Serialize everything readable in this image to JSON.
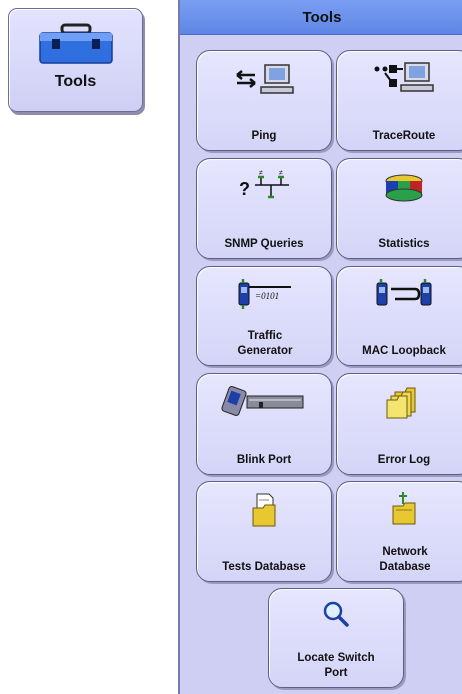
{
  "launcher": {
    "label": "Tools",
    "icon": "toolbox-icon"
  },
  "panel": {
    "title": "Tools",
    "items": [
      {
        "label": "Ping",
        "icon": "ping-icon"
      },
      {
        "label": "TraceRoute",
        "icon": "traceroute-icon"
      },
      {
        "label": "SNMP Queries",
        "icon": "snmp-queries-icon"
      },
      {
        "label": "Statistics",
        "icon": "statistics-icon"
      },
      {
        "label": "Traffic Generator",
        "icon": "traffic-generator-icon"
      },
      {
        "label": "MAC Loopback",
        "icon": "mac-loopback-icon"
      },
      {
        "label": "Blink Port",
        "icon": "blink-port-icon"
      },
      {
        "label": "Error Log",
        "icon": "error-log-icon"
      },
      {
        "label": "Tests Database",
        "icon": "tests-database-icon"
      },
      {
        "label": "Network Database",
        "icon": "network-database-icon"
      },
      {
        "label": "Locate Switch Port",
        "icon": "locate-switch-port-icon"
      }
    ]
  }
}
